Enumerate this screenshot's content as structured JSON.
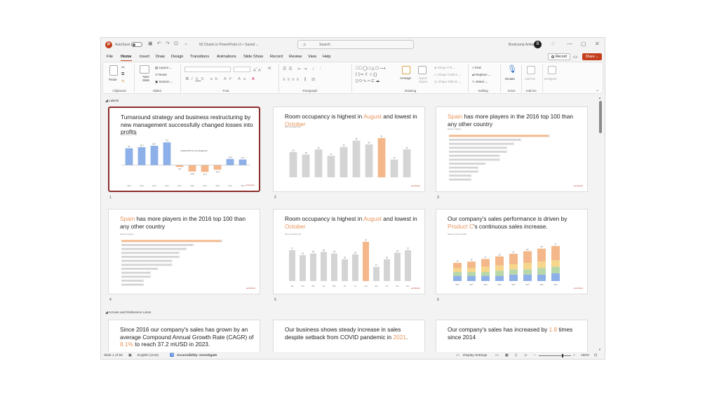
{
  "titlebar": {
    "autosave_label": "AutoSave",
    "document_title": "50 Charts in PowerPoint v1 • Saved ⌄",
    "search_placeholder": "Search",
    "user_name": "Bootcamp Amber",
    "user_initial": "B"
  },
  "menu": {
    "items": [
      "File",
      "Home",
      "Insert",
      "Draw",
      "Design",
      "Transitions",
      "Animations",
      "Slide Show",
      "Record",
      "Review",
      "View",
      "Help"
    ],
    "active": "Home",
    "record_label": "Record",
    "share_label": "Share"
  },
  "ribbon": {
    "groups": {
      "clipboard": "Clipboard",
      "slides": "Slides",
      "font": "Font",
      "paragraph": "Paragraph",
      "drawing": "Drawing",
      "editing": "Editing",
      "voice": "Voice",
      "addins": "Add-ins"
    },
    "paste_label": "Paste",
    "new_slide_label": "New Slide",
    "layout_label": "Layout",
    "reset_label": "Reset",
    "section_label": "Section",
    "arrange_label": "Arrange",
    "quick_styles_label": "Quick Styles",
    "shape_fill_label": "Shape Fill",
    "shape_outline_label": "Shape Outline",
    "shape_effects_label": "Shape Effects",
    "find_label": "Find",
    "replace_label": "Replace",
    "select_label": "Select",
    "dictate_label": "Dictate",
    "addins_label": "Add-ins",
    "designer_label": "Designer"
  },
  "sections": [
    {
      "label": "Labels"
    },
    {
      "label": "Arrows and Reference Lines"
    }
  ],
  "slides": [
    {
      "number": "1",
      "title_parts": [
        {
          "t": "Turnaround strategy and business restructuring by new management successfully changed losses into profits",
          "hl": false
        }
      ]
    },
    {
      "number": "2",
      "title_parts": [
        {
          "t": "Room occupancy is highest in ",
          "hl": false
        },
        {
          "t": "August",
          "hl": true
        },
        {
          "t": " and lowest in ",
          "hl": false
        },
        {
          "t": "October",
          "hl": true
        }
      ]
    },
    {
      "number": "3",
      "title_parts": [
        {
          "t": "Spain",
          "hl": true
        },
        {
          "t": " has more players in the 2016 top 100 than any other country",
          "hl": false
        }
      ]
    },
    {
      "number": "4",
      "title_parts": [
        {
          "t": "Spain",
          "hl": true
        },
        {
          "t": " has more players in the 2016 top 100 than any other country",
          "hl": false
        }
      ]
    },
    {
      "number": "5",
      "title_parts": [
        {
          "t": "Room occupancy is highest in ",
          "hl": false
        },
        {
          "t": "August",
          "hl": true
        },
        {
          "t": " and lowest in ",
          "hl": false
        },
        {
          "t": "October",
          "hl": true
        }
      ]
    },
    {
      "number": "6",
      "title_parts": [
        {
          "t": "Our company's sales performance is driven by ",
          "hl": false
        },
        {
          "t": "Product C",
          "hl": true
        },
        {
          "t": "'s continuous sales increase.",
          "hl": false
        }
      ]
    },
    {
      "number": "7",
      "title_parts": [
        {
          "t": "Since 2016 our company's sales has grown by an average Compound Annual Growth Rate (CAGR) of ",
          "hl": false
        },
        {
          "t": "8.1%",
          "hl": true
        },
        {
          "t": " to reach 37.2 mUSD in 2023.",
          "hl": false
        }
      ]
    },
    {
      "number": "8",
      "title_parts": [
        {
          "t": "Our business shows steady increase in sales despite setback from COVID pandemic in ",
          "hl": false
        },
        {
          "t": "2021",
          "hl": true
        },
        {
          "t": ".",
          "hl": false
        }
      ]
    },
    {
      "number": "9",
      "title_parts": [
        {
          "t": "Our company's sales has increased by ",
          "hl": false
        },
        {
          "t": "1.8",
          "hl": true
        },
        {
          "t": " times since 2014",
          "hl": false
        }
      ]
    }
  ],
  "slide_charts": {
    "s1": {
      "type": "bar",
      "values": [
        52.0,
        55.3,
        59.7,
        70.1,
        -5.6,
        -19.8,
        -21.1,
        -14.2,
        18.9,
        17.4
      ],
      "categories": [
        "2013",
        "2014",
        "2015",
        "2016",
        "2017",
        "2018",
        "2019",
        "2020",
        "2021",
        "2022"
      ],
      "annotation": "Acquired 2017 by new management"
    },
    "s2": {
      "type": "bar",
      "values": [
        20,
        18,
        22,
        17,
        24,
        29,
        26,
        31,
        14,
        22
      ],
      "highlight_index": 7
    },
    "s3": {
      "type": "bar-horizontal",
      "values": [
        14,
        10,
        9,
        8,
        8,
        7,
        7,
        5,
        4,
        4,
        3,
        3
      ]
    },
    "s4": {
      "type": "bar-horizontal",
      "values": [
        14,
        10,
        9,
        8,
        8,
        7,
        7,
        5,
        4,
        4,
        3,
        3
      ]
    },
    "s5": {
      "type": "bar",
      "values": [
        37,
        31,
        33,
        35,
        33,
        26,
        32,
        47,
        17,
        26,
        34,
        37
      ],
      "highlight_index": 7,
      "categories": [
        "Jan",
        "Feb",
        "Mar",
        "Apr",
        "May",
        "Jun",
        "Jul",
        "Aug",
        "Sep",
        "Oct",
        "Nov",
        "Dec"
      ]
    },
    "s6": {
      "type": "stacked-bar",
      "stacks": [
        [
          4,
          3,
          3,
          4
        ],
        [
          4,
          3,
          3,
          5
        ],
        [
          4,
          3,
          4,
          6
        ],
        [
          4,
          4,
          4,
          7
        ],
        [
          5,
          4,
          4,
          8
        ],
        [
          5,
          4,
          5,
          9
        ],
        [
          5,
          5,
          5,
          10
        ],
        [
          6,
          5,
          5,
          11
        ]
      ],
      "categories": [
        "2016",
        "2017",
        "2018",
        "2019",
        "2020",
        "2021",
        "2022",
        "2023"
      ]
    }
  },
  "statusbar": {
    "slide_count": "Slide 1 of 50",
    "language": "English (UAE)",
    "accessibility": "Accessibility: Investigate",
    "display_settings": "Display Settings",
    "zoom": "150%"
  },
  "colors": {
    "accent": "#c43e1c",
    "highlight": "#e8935a",
    "bar_blue": "#8eb0e8",
    "bar_orange": "#f3b78a",
    "bar_grey": "#d4d4d4"
  }
}
